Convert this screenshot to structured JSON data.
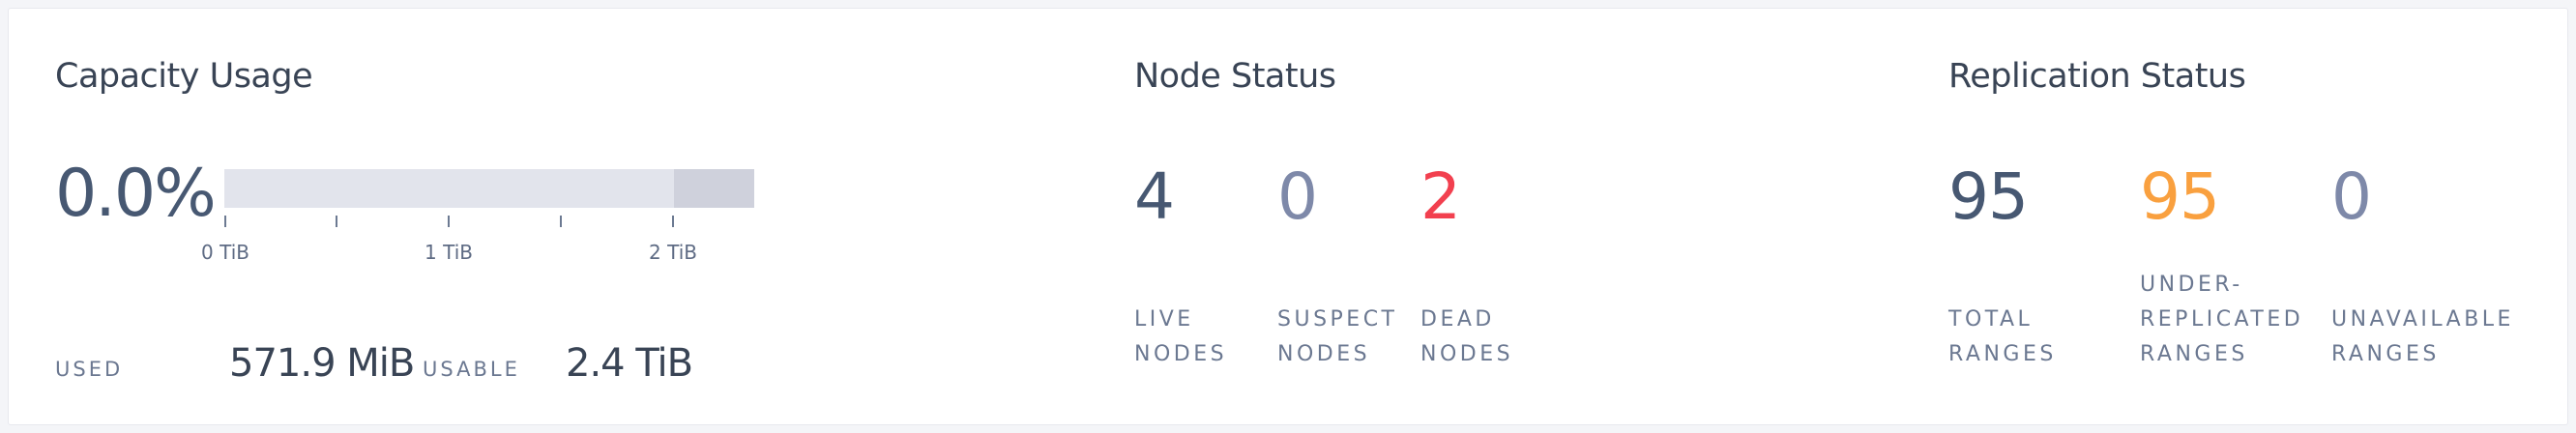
{
  "capacity": {
    "title": "Capacity Usage",
    "percent": "0.0%",
    "ticks": [
      "0 TiB",
      "1 TiB",
      "2 TiB"
    ],
    "used_label": "USED",
    "used_value": "571.9 MiB",
    "usable_label": "USABLE",
    "usable_value": "2.4 TiB"
  },
  "nodes": {
    "title": "Node Status",
    "stats": [
      {
        "value": "4",
        "label": "LIVE\nNODES",
        "color": "#475872"
      },
      {
        "value": "0",
        "label": "SUSPECT\nNODES",
        "color": "#7e89a9"
      },
      {
        "value": "2",
        "label": "DEAD\nNODES",
        "color": "#f2404f"
      }
    ]
  },
  "replication": {
    "title": "Replication Status",
    "stats": [
      {
        "value": "95",
        "label": "TOTAL\nRANGES",
        "color": "#475872"
      },
      {
        "value": "95",
        "label": "UNDER-\nREPLICATED\nRANGES",
        "color": "#f9a03f"
      },
      {
        "value": "0",
        "label": "UNAVAILABLE\nRANGES",
        "color": "#7e89a9"
      }
    ]
  }
}
